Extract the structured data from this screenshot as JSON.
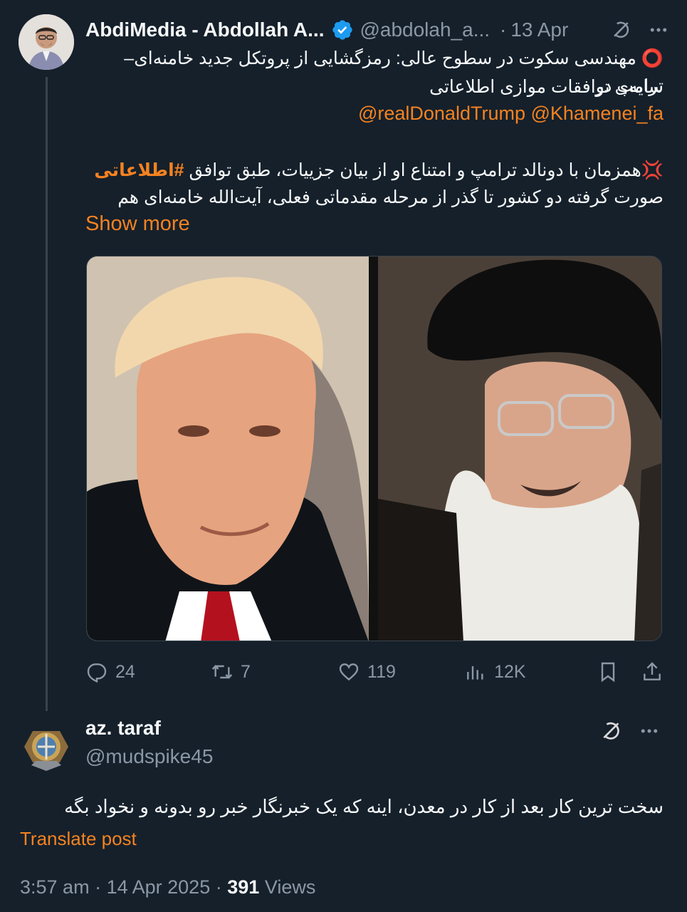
{
  "tweet": {
    "author_name": "AbdiMedia - Abdollah A...",
    "author_handle": "@abdolah_a...",
    "separator": "·",
    "date": "13 Apr",
    "line1": "⭕️ مهندسی سکوت در سطوح عالی: رمزگشایی از پروتکل جدید خامنه‌ای–ترامپ در",
    "line2": "سایه‌ی توافقات موازی اطلاعاتی",
    "mentions": "@realDonaldTrump @Khamenei_fa",
    "line3_prefix": "💢همزمان با دونالد ترامپ و امتناع او از بیان جزییات، طبق توافق",
    "line3_hashtag": "#اطلاعاتی",
    "line4": "صورت گرفته دو کشور تا گذر از مرحله مقدماتی فعلی، آیت‌الله خامنه‌ای هم",
    "show_more": "Show more",
    "stats": {
      "replies": "24",
      "reposts": "7",
      "likes": "119",
      "views": "12K"
    }
  },
  "reply": {
    "author_name": "az. taraf",
    "author_handle": "@mudspike45",
    "text": "سخت ترین کار بعد از کار در معدن،  اینه که  یک  خبرنگار خبر رو بدونه و نخواد بگه",
    "translate": "Translate post",
    "time": "3:57 am",
    "date": "14 Apr 2025",
    "views_count": "391",
    "views_label": "Views"
  },
  "colors": {
    "background": "#15202b",
    "accent": "#f58220",
    "muted": "#8b98a5",
    "verified": "#1d9bf0"
  },
  "icons": [
    "verified-badge-icon",
    "grok-icon",
    "more-icon",
    "reply-icon",
    "repost-icon",
    "like-icon",
    "views-icon",
    "bookmark-icon",
    "share-icon"
  ]
}
